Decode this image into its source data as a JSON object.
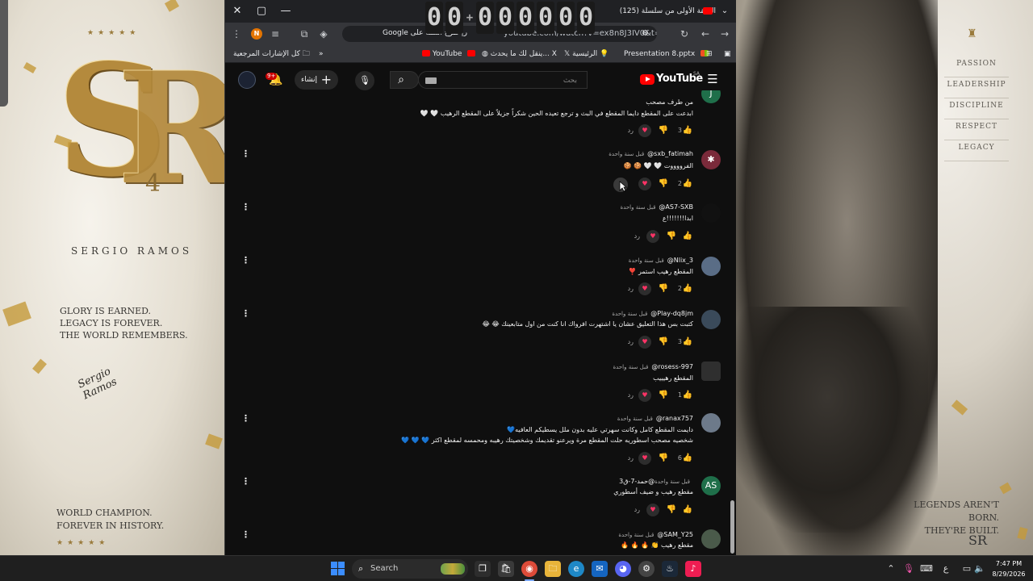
{
  "wallpaper": {
    "stars": "★★★★★",
    "logo_letters_s": "S",
    "logo_letters_r": "R",
    "logo_number": "4",
    "name": "SERGIO RAMOS",
    "tagline_lines": [
      "GLORY IS EARNED.",
      "LEGACY IS FOREVER.",
      "THE WORLD REMEMBERS."
    ],
    "signature": "Sergio Ramos",
    "champ_lines": [
      "WORLD CHAMPION.",
      "FOREVER IN HISTORY."
    ],
    "right_menu": [
      "PASSION",
      "LEADERSHIP",
      "DISCIPLINE",
      "RESPECT",
      "LEGACY"
    ],
    "legends_lines": [
      "LEGENDS AREN'T BORN.",
      "THEY'RE BUILT."
    ],
    "mini_logo": "SR"
  },
  "browser": {
    "tab_title": "(125) الحلقة الأولى من سلسلة",
    "url_suggestion": "Google ر| طرح أسئلة على",
    "url_text": "youtube.com/watch?v=ex8n8J3IV0&t=1s",
    "timer_digits": [
      "0",
      "0",
      "0",
      "0",
      "0",
      "0",
      "0",
      "0"
    ],
    "bookmarks": {
      "all_bookmarks": "كل الإشارات المرجعية",
      "b1": "YouTube",
      "b2": "ينقل لك ما يحدث... X",
      "b3": "الرئيسية",
      "b4": "Presentation 8.pptx"
    }
  },
  "youtube": {
    "logo_word": "YouTube",
    "region": "SA",
    "search_placeholder": "بحث",
    "create_label": "إنشاء",
    "notification_count": "9+"
  },
  "comments": [
    {
      "author": "",
      "time": "",
      "text_lines": [
        "من طرف مصحب",
        "ابدعت على المقطع دايما المقطع في البث و ترجع تعيده الحين شكراً جزيلاً على المقطع الرهيب 🤍 🤍"
      ],
      "likes": "3",
      "reply": "رد",
      "avatar_text": "J",
      "avatar_color": "#1f6f4a"
    },
    {
      "author": "@sxb_fatimah",
      "time": "قبل سنة واحدة",
      "text_lines": [
        "الفرووووت 🤍 🤍 🍪 🍪"
      ],
      "likes": "2",
      "reply": "رد",
      "avatar_text": "✱",
      "avatar_color": "#7a2a3a"
    },
    {
      "author": "@AS7-SXB",
      "time": "قبل سنة واحدة",
      "text_lines": [
        "ابدا!!!!!!!ع"
      ],
      "likes": "",
      "reply": "رد",
      "avatar_text": "",
      "avatar_color": "#111111"
    },
    {
      "author": "@Nlix_3",
      "time": "قبل سنة واحدة",
      "text_lines": [
        "المقطع رهيب استمر ❣️"
      ],
      "likes": "2",
      "reply": "رد",
      "avatar_text": "",
      "avatar_color": "#5a6d86"
    },
    {
      "author": "@Play-dq8jm",
      "time": "قبل سنة واحدة",
      "text_lines": [
        "كتبت بس هذا التعليق عشان يا اشتهرت افرواك انا كنت من اول متابعينك 😂 😂"
      ],
      "likes": "3",
      "reply": "رد",
      "avatar_text": "",
      "avatar_color": "#3a4a5a"
    },
    {
      "author": "@rosess-997",
      "time": "قبل سنة واحدة",
      "text_lines": [
        "المقطع رهيييب"
      ],
      "likes": "1",
      "reply": "رد",
      "avatar_text": "",
      "avatar_color": "#2f2f2f"
    },
    {
      "author": "@ranax757",
      "time": "قبل سنة واحدة",
      "text_lines": [
        "دايمت المقطع كامل وكانت سهرتي عليه بدون ملل يسطيكم العافيه💙",
        "شخصيه مصحب اسطوريه حلت المقطع مرة ويرعنو تقديمك وشخصيتك رهيبه ومحمسه لمقطع اكثر 💙 💙 💙"
      ],
      "likes": "6",
      "reply": "رد",
      "avatar_text": "",
      "avatar_color": "#6d7a8a"
    },
    {
      "author": "@حمد-7-ق3",
      "time": "قبل سنة واحدة",
      "text_lines": [
        "مقطع رهيب و ضيف أسطوري"
      ],
      "likes": "",
      "reply": "رد",
      "avatar_text": "AS",
      "avatar_color": "#1f6f4a"
    },
    {
      "author": "@SAM_Y25",
      "time": "قبل سنة واحدة",
      "text_lines": [
        "مقطع رهيب 👏 🔥 🔥 🔥"
      ],
      "likes": "",
      "reply": "",
      "avatar_text": "",
      "avatar_color": "#4a5a4a"
    }
  ],
  "taskbar": {
    "search_label": "Search",
    "time": "7:47 PM",
    "date": "8/29/2026",
    "lang": "ع"
  }
}
